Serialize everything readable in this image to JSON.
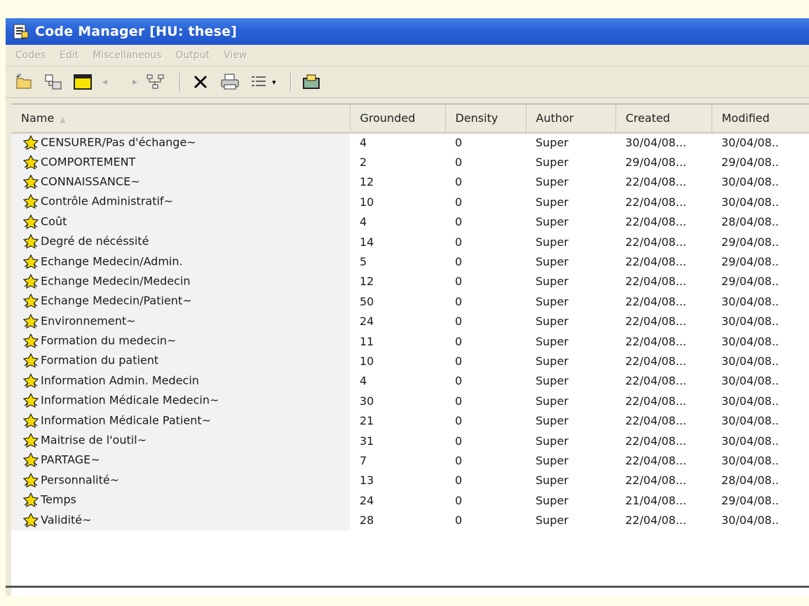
{
  "window": {
    "title": "Code Manager [HU: these]"
  },
  "menu": [
    "Codes",
    "Edit",
    "Miscellaneous",
    "Output",
    "View"
  ],
  "toolbar": {
    "icons": [
      "new-code-icon",
      "merge-icon",
      "window-icon",
      "prev-arrow-icon",
      "next-arrow-icon",
      "network-icon",
      "delete-icon",
      "print-icon",
      "list-view-icon",
      "export-icon"
    ],
    "accent": "#2a62d6"
  },
  "table": {
    "columns": [
      "Name",
      "Grounded",
      "Density",
      "Author",
      "Created",
      "Modified"
    ],
    "rows": [
      {
        "name": "CENSURER/Pas d'échange~",
        "grounded": "4",
        "density": "0",
        "author": "Super",
        "created": "30/04/08...",
        "modified": "30/04/08.."
      },
      {
        "name": "COMPORTEMENT",
        "grounded": "2",
        "density": "0",
        "author": "Super",
        "created": "29/04/08...",
        "modified": "29/04/08.."
      },
      {
        "name": "CONNAISSANCE~",
        "grounded": "12",
        "density": "0",
        "author": "Super",
        "created": "22/04/08...",
        "modified": "30/04/08.."
      },
      {
        "name": "Contrôle Administratif~",
        "grounded": "10",
        "density": "0",
        "author": "Super",
        "created": "22/04/08...",
        "modified": "30/04/08.."
      },
      {
        "name": "Coût",
        "grounded": "4",
        "density": "0",
        "author": "Super",
        "created": "22/04/08...",
        "modified": "28/04/08.."
      },
      {
        "name": "Degré de nécéssité",
        "grounded": "14",
        "density": "0",
        "author": "Super",
        "created": "22/04/08...",
        "modified": "29/04/08.."
      },
      {
        "name": "Echange Medecin/Admin.",
        "grounded": "5",
        "density": "0",
        "author": "Super",
        "created": "22/04/08...",
        "modified": "29/04/08.."
      },
      {
        "name": "Echange Medecin/Medecin",
        "grounded": "12",
        "density": "0",
        "author": "Super",
        "created": "22/04/08...",
        "modified": "29/04/08.."
      },
      {
        "name": "Echange Medecin/Patient~",
        "grounded": "50",
        "density": "0",
        "author": "Super",
        "created": "22/04/08...",
        "modified": "30/04/08.."
      },
      {
        "name": "Environnement~",
        "grounded": "24",
        "density": "0",
        "author": "Super",
        "created": "22/04/08...",
        "modified": "30/04/08.."
      },
      {
        "name": "Formation du medecin~",
        "grounded": "11",
        "density": "0",
        "author": "Super",
        "created": "22/04/08...",
        "modified": "30/04/08.."
      },
      {
        "name": "Formation du patient",
        "grounded": "10",
        "density": "0",
        "author": "Super",
        "created": "22/04/08...",
        "modified": "30/04/08.."
      },
      {
        "name": "Information Admin. Medecin",
        "grounded": "4",
        "density": "0",
        "author": "Super",
        "created": "22/04/08...",
        "modified": "30/04/08.."
      },
      {
        "name": "Information Médicale Medecin~",
        "grounded": "30",
        "density": "0",
        "author": "Super",
        "created": "22/04/08...",
        "modified": "30/04/08.."
      },
      {
        "name": "Information Médicale Patient~",
        "grounded": "21",
        "density": "0",
        "author": "Super",
        "created": "22/04/08...",
        "modified": "30/04/08.."
      },
      {
        "name": "Maitrise de l'outil~",
        "grounded": "31",
        "density": "0",
        "author": "Super",
        "created": "22/04/08...",
        "modified": "30/04/08.."
      },
      {
        "name": "PARTAGE~",
        "grounded": "7",
        "density": "0",
        "author": "Super",
        "created": "22/04/08...",
        "modified": "30/04/08.."
      },
      {
        "name": "Personnalité~",
        "grounded": "13",
        "density": "0",
        "author": "Super",
        "created": "22/04/08...",
        "modified": "28/04/08.."
      },
      {
        "name": "Temps",
        "grounded": "24",
        "density": "0",
        "author": "Super",
        "created": "21/04/08...",
        "modified": "29/04/08.."
      },
      {
        "name": "Validité~",
        "grounded": "28",
        "density": "0",
        "author": "Super",
        "created": "22/04/08...",
        "modified": "30/04/08.."
      }
    ]
  }
}
